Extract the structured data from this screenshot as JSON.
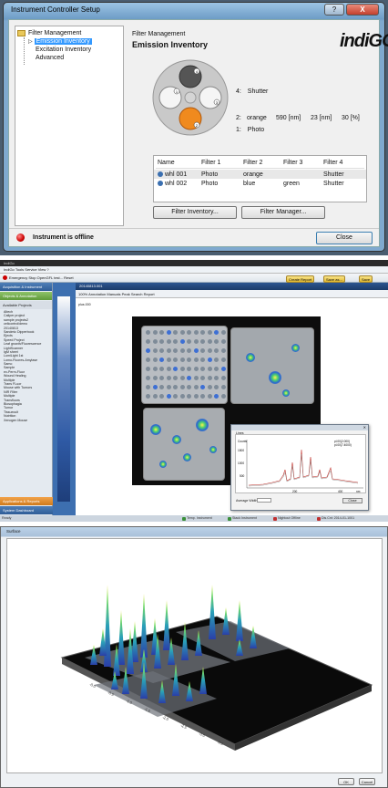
{
  "panel1": {
    "window_title": "Instrument Controller Setup",
    "title_buttons": [
      "?",
      "X"
    ],
    "tree": {
      "root": "Filter Management",
      "items": [
        {
          "label": "Emission Inventory",
          "selected": true
        },
        {
          "label": "Excitation Inventory",
          "selected": false
        },
        {
          "label": "Advanced",
          "selected": false
        }
      ]
    },
    "header_small": "Filter Management",
    "header_large": "Emission Inventory",
    "logo_text": "indiGO",
    "wheel": {
      "positions": [
        "4",
        "1",
        "2",
        "3"
      ],
      "position_colors": {
        "4": "#555555",
        "1": "#dddddd",
        "2": "#dddddd",
        "3": "#f08a1e"
      }
    },
    "info": [
      {
        "pos": "4:",
        "name": "Shutter",
        "nm": "",
        "bw": "",
        "pct": ""
      },
      {
        "pos": "2:",
        "name": "orange",
        "nm": "590 [nm]",
        "bw": "23 [nm]",
        "pct": "30 [%]"
      },
      {
        "pos": "1:",
        "name": "Photo",
        "nm": "",
        "bw": "",
        "pct": ""
      }
    ],
    "table": {
      "headers": [
        "Name",
        "Filter 1",
        "Filter 2",
        "Filter 3",
        "Filter 4"
      ],
      "rows": [
        [
          "whl 001",
          "Photo",
          "orange",
          "",
          "Shutter"
        ],
        [
          "whl 002",
          "Photo",
          "blue",
          "green",
          "Shutter"
        ]
      ]
    },
    "buttons": {
      "filter_inventory": "Filter Inventory...",
      "filter_manager": "Filter Manager...",
      "close": "Close"
    },
    "status": "Instrument is offline"
  },
  "panel2": {
    "app_title": "IndiGo",
    "menu": "IndiGo   Tools   Service   View   ?",
    "toolbar": "Emergency Stop      OpenGFL test...      Reset",
    "left_header_1": "Acquisition & Instrument",
    "left_header_2": "Objects & Annotation",
    "tree_header": "Available Projects",
    "tree_items": [
      "Available Projects",
      "Altech",
      "Caliper project",
      "sample projects2",
      "cellcontrol/demo",
      "20140813",
      "Sandmic Dipperbook",
      "Ejects",
      "Speed Project",
      "Leaf growth/Fluorescence",
      "LightScanner",
      "IgM sheet",
      "LumiLight 1st",
      "Lomo-Fluores-Amylase",
      "Samo",
      "Sample",
      "ex-Perm-Fluor",
      "Wound Healing",
      "Multiple",
      "Trans FLuor",
      "Mouse with Tumors",
      "NIR Filter",
      "Multiple",
      "Transfluors",
      "Biosophagia",
      "Tumor",
      "Tissuecult",
      "Nutrition",
      "Xenogen Mouse"
    ],
    "bottom_header_1": "Applications & Reports",
    "bottom_header_2": "System Dashboard",
    "tab_label": "20140813.001",
    "image_toolbar": "100%   Annotation   Manuals   Peak Search   Report",
    "action_buttons": [
      "Create Report",
      "Save as...",
      "Save"
    ],
    "side_label": "plus.000",
    "popup": {
      "title_label": "Lines",
      "y_label": "Counts",
      "legend": [
        "pl.00(2.000)",
        "pl.00(7.4000)"
      ],
      "y_ticks": [
        "1500",
        "1000",
        "500"
      ],
      "x_ticks": [
        "200",
        "400"
      ],
      "x_label": "nm",
      "average_width_label": "Average Width:",
      "close_label": "Close"
    },
    "status": "Ready",
    "status_items": [
      "Temp. Instrument",
      "Stack Instrument",
      "Nightout Offline",
      "Dis.Cnt: 2014-01-1001"
    ]
  },
  "panel3": {
    "window_title": "Surface",
    "buttons": {
      "ok": "OK",
      "cancel": "Cancel"
    },
    "axis_ticks": [
      "-0.0",
      "-0.5",
      "-1.0",
      "-1.5",
      "-2.0",
      "-2.5",
      "-3.0",
      "-3.5"
    ]
  }
}
